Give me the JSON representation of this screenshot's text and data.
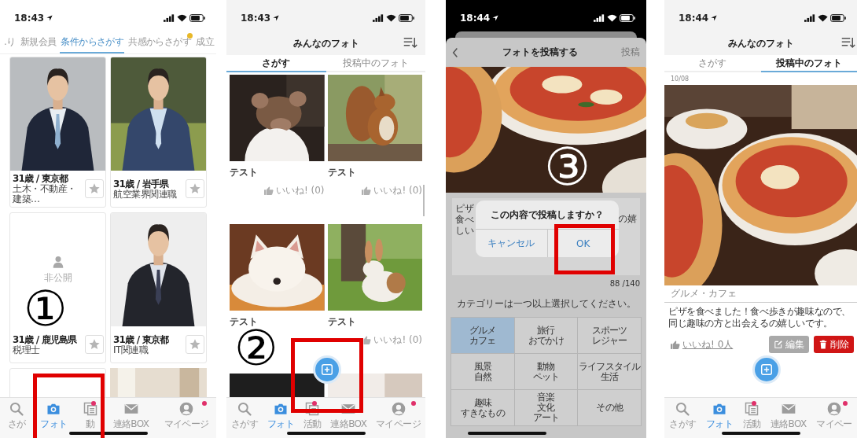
{
  "search_screen": {
    "time": "18:43",
    "tabs": [
      {
        "label": ".り",
        "selected": false,
        "badge": false
      },
      {
        "label": "新規会員",
        "selected": false,
        "badge": false
      },
      {
        "label": "条件からさがす",
        "selected": true,
        "badge": false
      },
      {
        "label": "共感からさがす",
        "selected": false,
        "badge": true
      },
      {
        "label": "成立",
        "selected": false,
        "badge": false
      }
    ],
    "cards": [
      {
        "kind": "photo_profile",
        "line_1": "31歳 / 東京都",
        "line_2": "土木・不動産・建築…",
        "favorite": false
      },
      {
        "kind": "photo_profile",
        "line_1": "31歳 / 岩手県",
        "line_2": "航空業界関連職",
        "favorite": false
      },
      {
        "kind": "private_profile",
        "private_label": "非公開",
        "line_1": "31歳 / 鹿児島県",
        "line_2": "税理士",
        "favorite": false
      },
      {
        "kind": "photo_profile",
        "line_1": "31歳 / 東京都",
        "line_2": "IT関連職",
        "favorite": false
      },
      {
        "kind": "blank_partial"
      },
      {
        "kind": "photo_partial"
      }
    ],
    "step": "①",
    "tab_bar": [
      {
        "label": "さが",
        "selected": false,
        "badge": false
      },
      {
        "label": "フォト",
        "selected": true,
        "badge": false
      },
      {
        "label": "動",
        "selected": false,
        "badge": true
      },
      {
        "label": "連絡BOX",
        "selected": false,
        "badge": false
      },
      {
        "label": "マイページ",
        "selected": false,
        "badge": true
      }
    ]
  },
  "photo_list_screen": {
    "time": "18:43",
    "title": "みんなのフォト",
    "tabs": [
      {
        "label": "さがす",
        "selected": true
      },
      {
        "label": "投稿中のフォト",
        "selected": false
      }
    ],
    "posts": [
      {
        "kind": "post",
        "title": "テスト",
        "like": "いいね! (0)"
      },
      {
        "kind": "post",
        "title": "テスト",
        "like": "いいね! (0)"
      },
      {
        "kind": "post",
        "title": "テスト"
      },
      {
        "kind": "post",
        "title": "テスト",
        "like": "いいね! (0)"
      },
      {
        "kind": "photo_only"
      },
      {
        "kind": "photo_only"
      }
    ],
    "step": "②",
    "tab_bar": [
      {
        "label": "さがす",
        "selected": false,
        "badge": false
      },
      {
        "label": "フォト",
        "selected": true,
        "badge": false
      },
      {
        "label": "活動",
        "selected": false,
        "badge": true
      },
      {
        "label": "連絡BOX",
        "selected": false,
        "badge": false
      },
      {
        "label": "マイページ",
        "selected": false,
        "badge": true
      }
    ]
  },
  "post_screen": {
    "time": "18:44",
    "title": "フォトを投稿する",
    "post_button": "投稿",
    "step": "③",
    "description_left": [
      "ピザ",
      "食べ",
      "しい"
    ],
    "description_right": "の嬉",
    "counter": "88 /140",
    "hint": "カテゴリーは一つ以上選択してください。",
    "categories": [
      {
        "lines": [
          "グルメ",
          "カフェ"
        ],
        "selected": true
      },
      {
        "lines": [
          "旅行",
          "おでかけ"
        ],
        "selected": false
      },
      {
        "lines": [
          "スポーツ",
          "レジャー"
        ],
        "selected": false
      },
      {
        "lines": [
          "風景",
          "自然"
        ],
        "selected": false
      },
      {
        "lines": [
          "動物",
          "ペット"
        ],
        "selected": false
      },
      {
        "lines": [
          "ライフスタイル",
          "生活"
        ],
        "selected": false
      },
      {
        "lines": [
          "趣味",
          "すきなもの"
        ],
        "selected": false
      },
      {
        "lines": [
          "音楽",
          "文化",
          "アート"
        ],
        "selected": false
      },
      {
        "lines": [
          "その他"
        ],
        "selected": false
      }
    ],
    "dialog": {
      "title": "この内容で投稿しますか？",
      "cancel": "キャンセル",
      "ok": "OK"
    }
  },
  "my_photos_screen": {
    "time": "18:44",
    "title": "みんなのフォト",
    "tabs": [
      {
        "label": "さがす",
        "selected": false
      },
      {
        "label": "投稿中のフォト",
        "selected": true
      }
    ],
    "date": "10/08",
    "category": "グルメ・カフェ",
    "description": "ピザを食べました！食べ歩きが趣味なので、同じ趣味の方と出会えるの嬉しいです。",
    "like": "いいね! 0人",
    "edit": "編集",
    "delete": "削除",
    "tab_bar": [
      {
        "label": "さがす",
        "selected": false,
        "badge": false
      },
      {
        "label": "フォト",
        "selected": true,
        "badge": false
      },
      {
        "label": "活動",
        "selected": false,
        "badge": true
      },
      {
        "label": "連絡BOX",
        "selected": false,
        "badge": false
      },
      {
        "label": "マイペー",
        "selected": false,
        "badge": true
      }
    ]
  }
}
